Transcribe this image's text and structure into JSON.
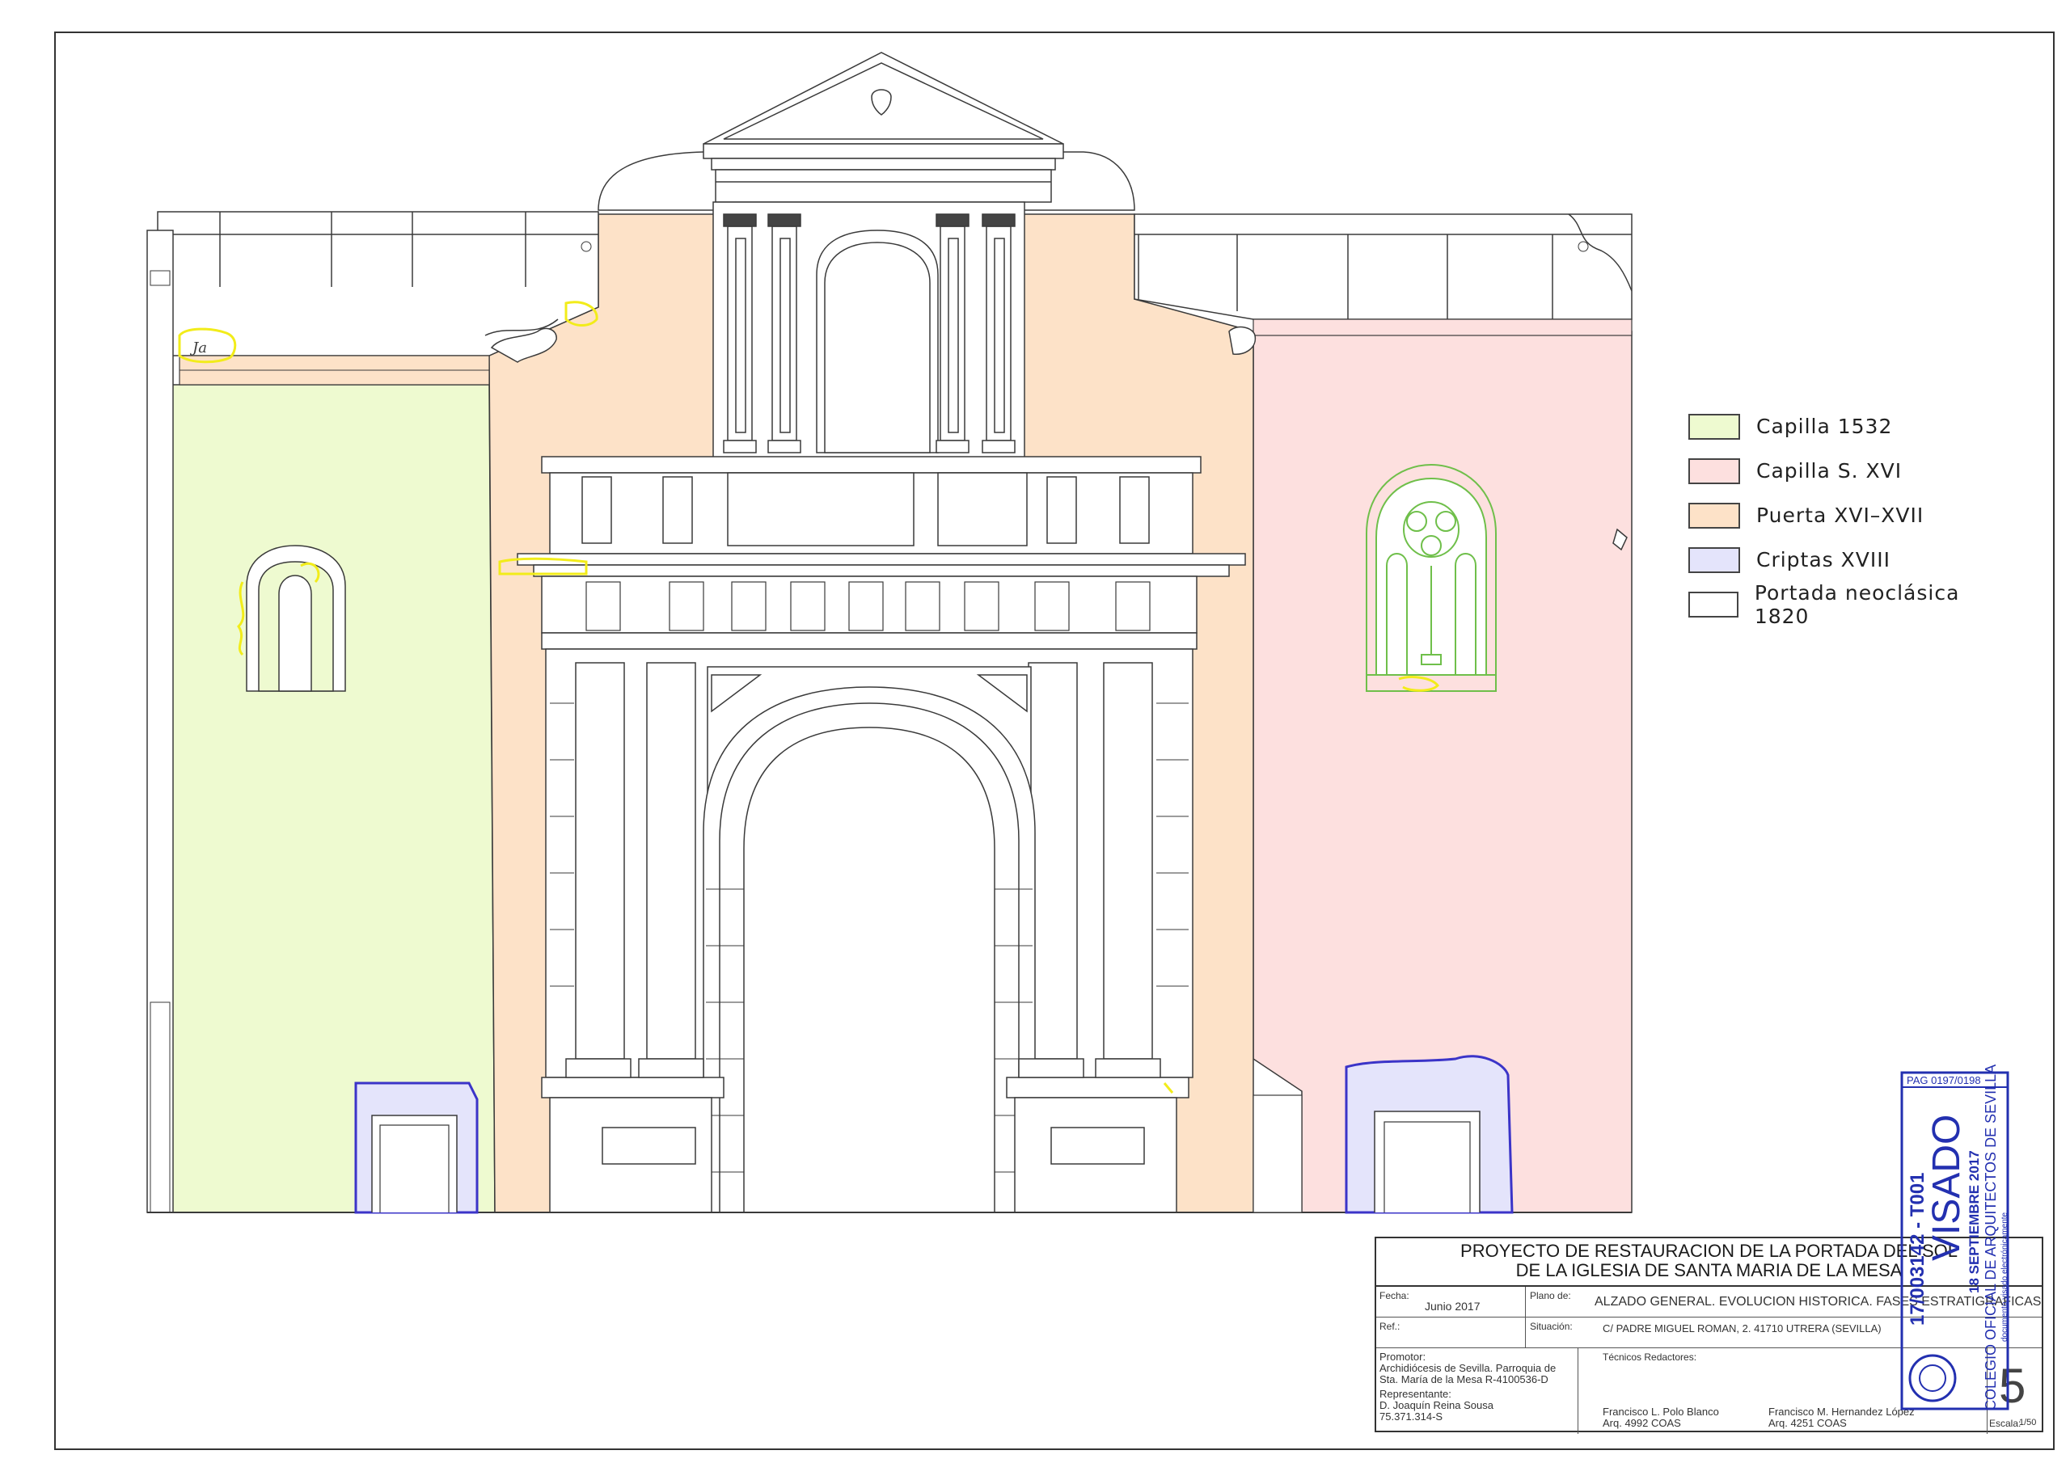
{
  "legend": [
    {
      "label": "Capilla 1532",
      "color": "#eefad0"
    },
    {
      "label": "Capilla S. XVI",
      "color": "#fde0df"
    },
    {
      "label": "Puerta XVI–XVII",
      "color": "#fde2c8"
    },
    {
      "label": "Criptas XVIII",
      "color": "#e4e4fb"
    },
    {
      "label": "Portada neoclásica 1820",
      "color": "#ffffff"
    }
  ],
  "annotation": "Ja",
  "title_block": {
    "title_line1": "PROYECTO DE RESTAURACION DE LA PORTADA DEL SOL",
    "title_line2": "DE LA IGLESIA DE SANTA MARIA DE LA MESA",
    "fecha_label": "Fecha:",
    "fecha_value": "Junio 2017",
    "plano_label": "Plano de:",
    "plano_value": "ALZADO GENERAL. EVOLUCION HISTORICA. FASES ESTRATIGRAFICAS",
    "ref_label": "Ref.:",
    "situacion_label": "Situación:",
    "situacion_value": "C/ PADRE MIGUEL ROMAN, 2.  41710 UTRERA (SEVILLA)",
    "promotor_label": "Promotor:",
    "promotor_line1": "Archidiócesis de Sevilla. Parroquia de",
    "promotor_line2": "Sta. María de la Mesa  R-4100536-D",
    "representante_label": "Representante:",
    "representante_line1": "D. Joaquín Reina Sousa",
    "representante_line2": "75.371.314-S",
    "tecnicos_label": "Técnicos Redactores:",
    "tec1_name": "Francisco L. Polo Blanco",
    "tec1_id": "Arq. 4992 COAS",
    "tec2_name": "Francisco M. Hernandez López",
    "tec2_id": "Arq. 4251 COAS",
    "sheet_number": "5",
    "escala_label": "Escala:",
    "escala_value": "1/50"
  },
  "stamp": {
    "page_ref": "PAG 0197/0198",
    "visado": "VISADO",
    "code": "17/003142 - T001",
    "date": "18 SEPTIEMBRE 2017",
    "college": "COLEGIO OFICIAL DE ARQUITECTOS DE SEVILLA",
    "note": "documento visado electrónicamente"
  },
  "colors": {
    "line": "#3a3a3a",
    "capilla_1532": "#eefad0",
    "capilla_xvi": "#fde0df",
    "puerta": "#fde2c8",
    "criptas": "#e4e4fb",
    "criptas_outline": "#3b34c8",
    "trace_green": "#6fbf4a",
    "trace_yellow": "#f2ec1a",
    "stamp_blue": "#2330b0"
  }
}
